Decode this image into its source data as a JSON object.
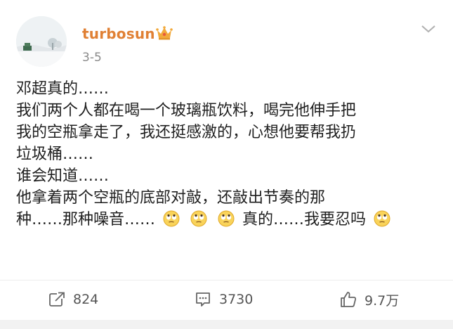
{
  "post": {
    "username": "turbosun",
    "date": "3-5",
    "lines": [
      "邓超真的……",
      "我们两个人都在喝一个玻璃瓶饮料，喝完他伸手把",
      "我的空瓶拿走了，我还挺感激的，心想他要帮我扔",
      "垃圾桶……",
      "谁会知道……",
      "他拿着两个空瓶的底部对敲，还敲出节奏的那"
    ],
    "last_line": {
      "part1": "种……那种噪音……",
      "part2": "真的……我要忍吗"
    },
    "emoji_names": [
      "eye-roll-emoji",
      "eye-roll-emoji",
      "eye-roll-emoji",
      "eye-roll-emoji"
    ]
  },
  "actions": {
    "repost_count": "824",
    "comment_count": "3730",
    "like_count": "9.7万"
  },
  "colors": {
    "username": "#e08034",
    "crown": "#f2a93b",
    "text": "#1f1f1f",
    "muted": "#8a8a8a"
  },
  "icons": [
    "verified-crown-icon",
    "chevron-down-icon",
    "repost-icon",
    "comment-icon",
    "like-icon"
  ]
}
